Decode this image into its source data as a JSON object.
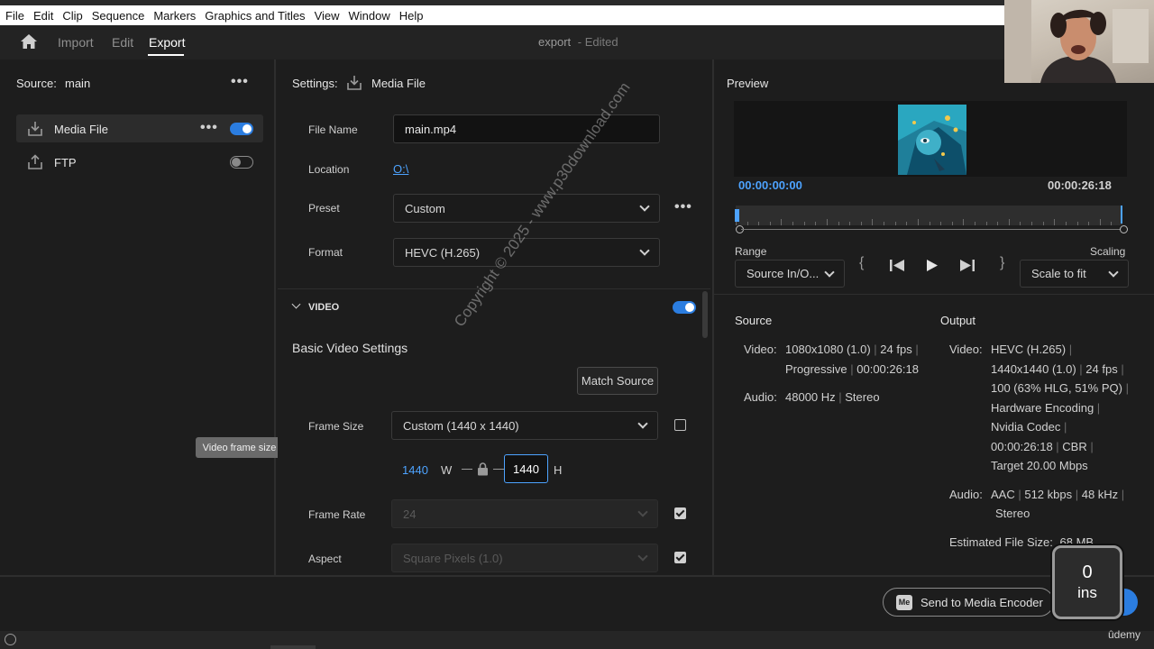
{
  "menu": [
    "File",
    "Edit",
    "Clip",
    "Sequence",
    "Markers",
    "Graphics and Titles",
    "View",
    "Window",
    "Help"
  ],
  "nav": {
    "import": "Import",
    "edit": "Edit",
    "export": "Export",
    "doc_name": "export",
    "doc_state": "- Edited"
  },
  "left": {
    "source_label": "Source:",
    "source_value": "main",
    "destinations": [
      {
        "label": "Media File",
        "enabled": true
      },
      {
        "label": "FTP",
        "enabled": false
      }
    ],
    "tooltip": "Video frame size"
  },
  "settings": {
    "title": "Settings:",
    "target": "Media File",
    "file_name_label": "File Name",
    "file_name_value": "main.mp4",
    "location_label": "Location",
    "location_value": "O:\\",
    "preset_label": "Preset",
    "preset_value": "Custom",
    "format_label": "Format",
    "format_value": "HEVC (H.265)",
    "video_section": "VIDEO",
    "video_enabled": true,
    "basic_video": "Basic Video Settings",
    "match_source": "Match Source",
    "frame_size_label": "Frame Size",
    "frame_size_value": "Custom (1440 x 1440)",
    "width_value": "1440",
    "w_label": "W",
    "height_value": "1440",
    "h_label": "H",
    "frame_rate_label": "Frame Rate",
    "frame_rate_value": "24",
    "aspect_label": "Aspect",
    "aspect_value": "Square Pixels (1.0)"
  },
  "watermark": "Copyright © 2025 - www.p30download.com",
  "preview": {
    "title": "Preview",
    "timecode_in": "00:00:00:00",
    "timecode_out": "00:00:26:18",
    "range_label": "Range",
    "range_value": "Source In/O...",
    "scaling_label": "Scaling",
    "scaling_value": "Scale to fit"
  },
  "source_info": {
    "title": "Source",
    "video_label": "Video:",
    "video_line1": [
      "1080x1080 (1.0)",
      "24 fps"
    ],
    "video_line2": [
      "Progressive",
      "00:00:26:18"
    ],
    "audio_label": "Audio:",
    "audio_line1": [
      "48000 Hz",
      "Stereo"
    ]
  },
  "output_info": {
    "title": "Output",
    "video_label": "Video:",
    "video_lines": [
      [
        "HEVC (H.265)"
      ],
      [
        "1440x1440 (1.0)",
        "24 fps"
      ],
      [
        "100 (63% HLG, 51% PQ)"
      ],
      [
        "Hardware Encoding"
      ],
      [
        "Nvidia Codec"
      ],
      [
        "00:00:26:18",
        "CBR"
      ],
      [
        "Target 20.00 Mbps"
      ]
    ],
    "audio_label": "Audio:",
    "audio_line1": [
      "AAC",
      "512 kbps",
      "48 kHz"
    ],
    "audio_line2": "Stereo",
    "estimated_label": "Estimated File Size:",
    "estimated_value": "68 MB"
  },
  "bottom": {
    "send_label": "Send to Media Encoder",
    "me_badge": "Me",
    "key_count": "0",
    "key_name": "ins",
    "brand": "ûdemy"
  },
  "colors": {
    "accent": "#2b7de0",
    "timecode": "#4da3ff"
  }
}
